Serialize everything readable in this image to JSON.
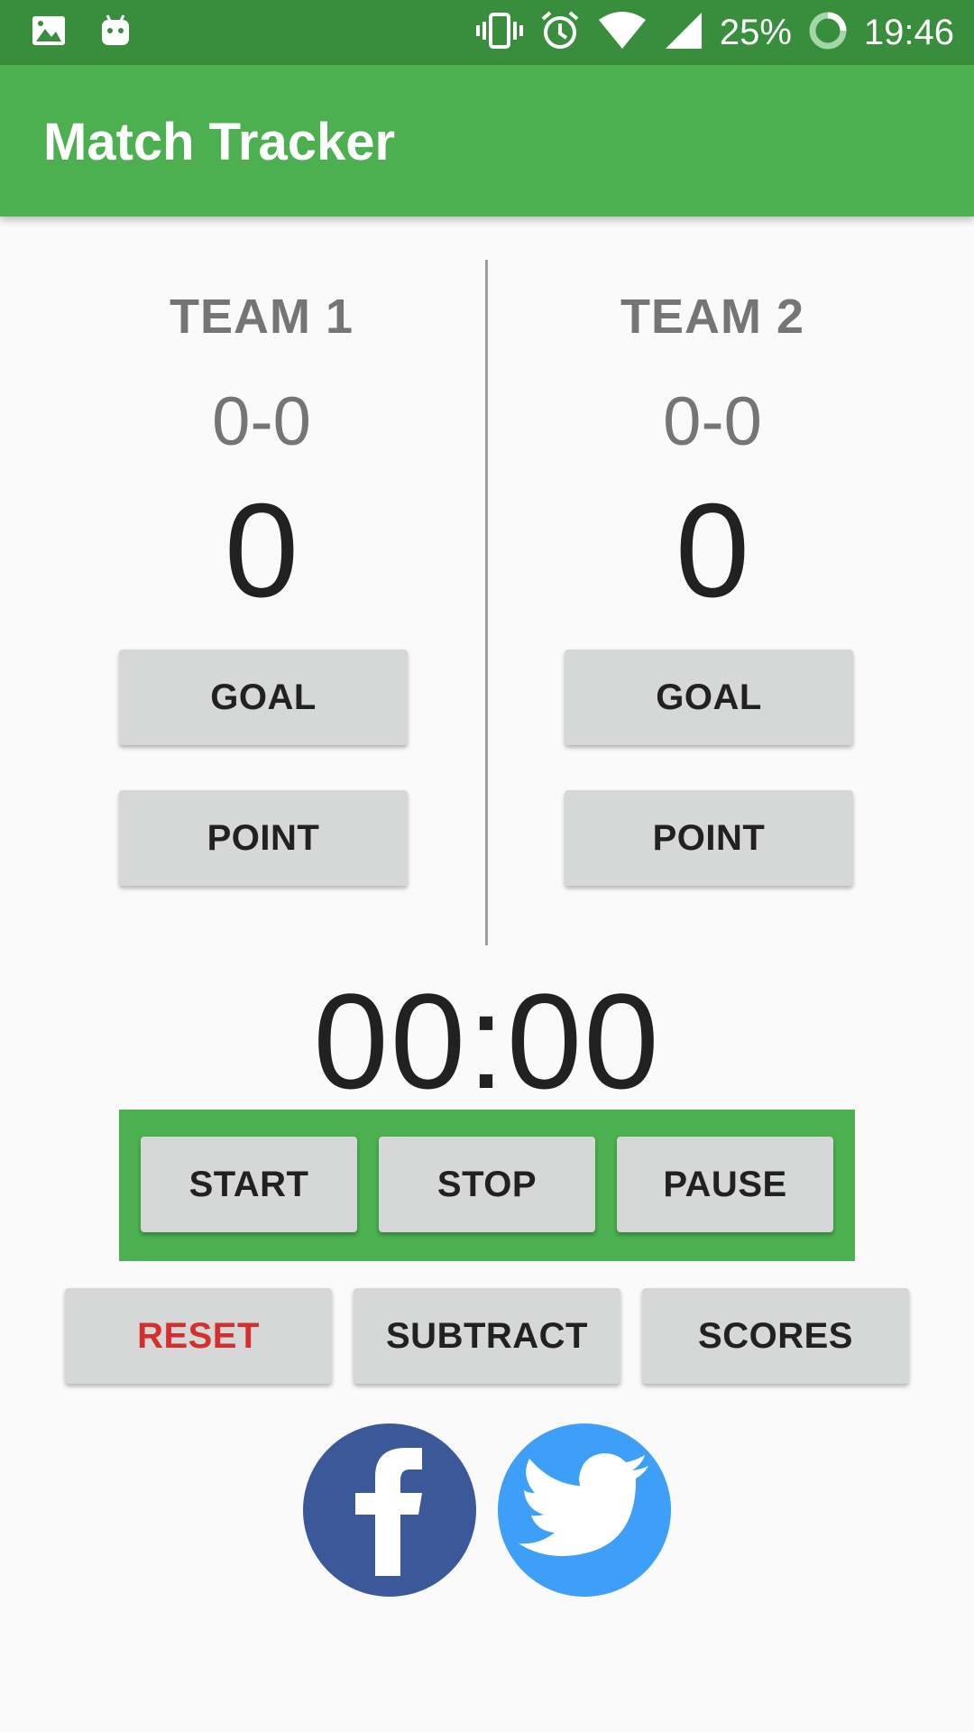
{
  "status_bar": {
    "battery": "25%",
    "time": "19:46"
  },
  "app_bar": {
    "title": "Match Tracker"
  },
  "team1": {
    "name": "TEAM 1",
    "record": "0-0",
    "score": "0",
    "goal_label": "GOAL",
    "point_label": "POINT"
  },
  "team2": {
    "name": "TEAM 2",
    "record": "0-0",
    "score": "0",
    "goal_label": "GOAL",
    "point_label": "POINT"
  },
  "timer": {
    "display": "00:00",
    "start_label": "START",
    "stop_label": "STOP",
    "pause_label": "PAUSE"
  },
  "actions": {
    "reset_label": "RESET",
    "subtract_label": "SUBTRACT",
    "scores_label": "SCORES"
  },
  "social": {
    "facebook_icon": "facebook-icon",
    "twitter_icon": "twitter-icon"
  },
  "colors": {
    "status_bar": "#388e3c",
    "app_bar": "#4caf50",
    "reset_text": "#d32f2f",
    "facebook": "#3b5998",
    "twitter": "#3d9ff7"
  }
}
